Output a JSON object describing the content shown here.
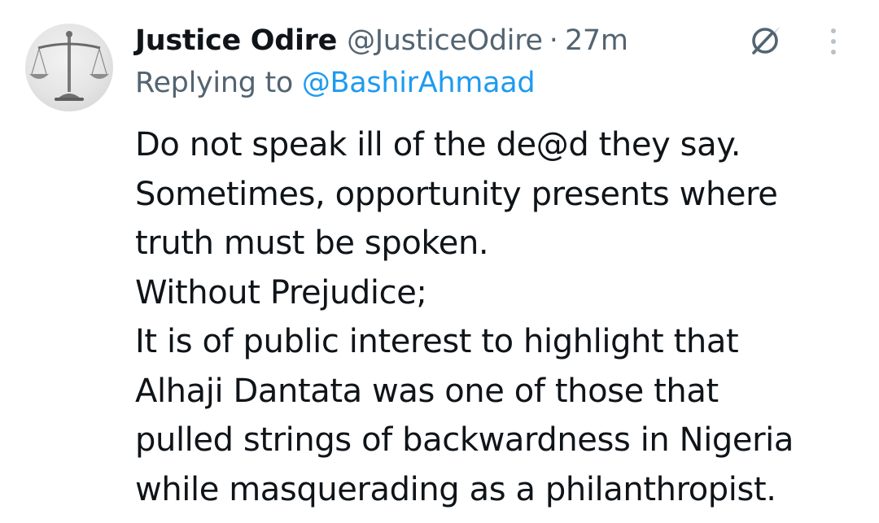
{
  "tweet": {
    "display_name": "Justice Odire",
    "handle": "@JusticeOdire",
    "separator": "·",
    "time": "27m",
    "replying_prefix": "Replying to ",
    "replying_to": "@BashirAhmaad",
    "lines": [
      "Do not speak ill of the de@d they say.",
      "Sometimes, opportunity presents where",
      "truth must be spoken.",
      "Without Prejudice;",
      "It is of public interest to highlight that",
      "Alhaji Dantata was one of those that",
      "pulled strings of backwardness in Nigeria",
      "while masquerading as a philanthropist."
    ]
  },
  "icons": {
    "avatar": "scales-of-justice-icon",
    "grok": "grok-icon",
    "more": "more-vertical-icon"
  },
  "colors": {
    "text": "#0f1419",
    "secondary": "#536471",
    "link": "#1d9bf0",
    "background": "#ffffff"
  }
}
